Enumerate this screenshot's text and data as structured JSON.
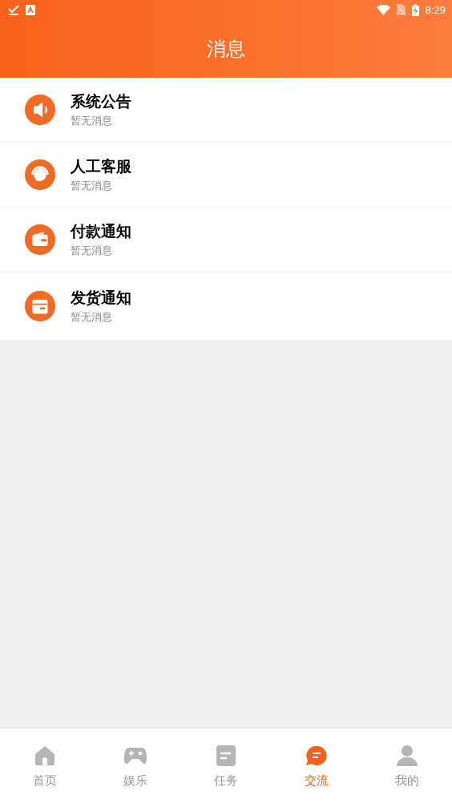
{
  "status_bar": {
    "time": "8:29"
  },
  "header": {
    "title": "消息"
  },
  "messages": [
    {
      "kind": "announce",
      "title": "系统公告",
      "subtitle": "暂无消息"
    },
    {
      "kind": "service",
      "title": "人工客服",
      "subtitle": "暂无消息"
    },
    {
      "kind": "payment",
      "title": "付款通知",
      "subtitle": "暂无消息"
    },
    {
      "kind": "shipping",
      "title": "发货通知",
      "subtitle": "暂无消息"
    }
  ],
  "tabs": [
    {
      "kind": "home",
      "label": "首页",
      "selected": false
    },
    {
      "kind": "game",
      "label": "娱乐",
      "selected": false
    },
    {
      "kind": "task",
      "label": "任务",
      "selected": false
    },
    {
      "kind": "chat",
      "label": "交流",
      "selected": true
    },
    {
      "kind": "user",
      "label": "我的",
      "selected": false
    }
  ]
}
